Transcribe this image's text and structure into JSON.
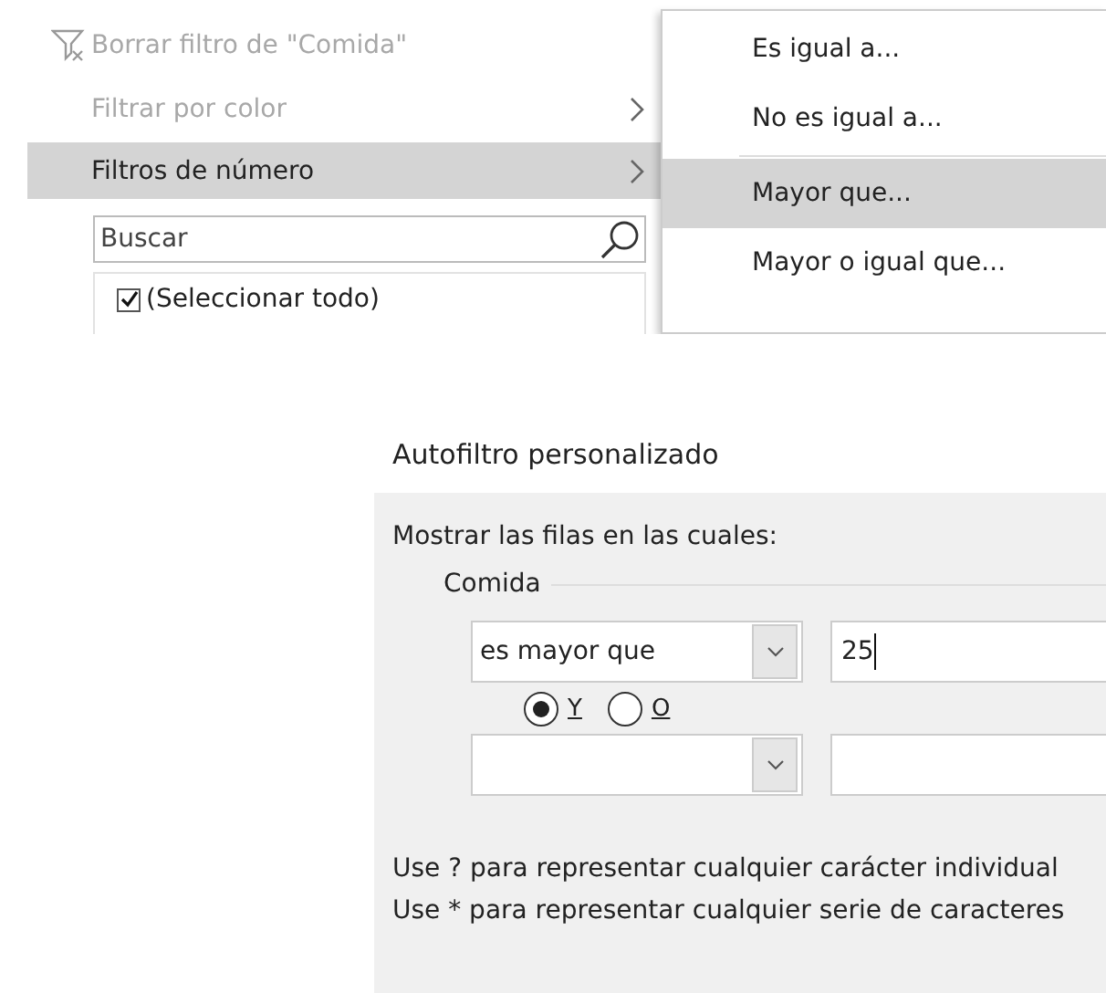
{
  "filter_menu": {
    "items": [
      {
        "kind": "command",
        "label": "Borrar filtro de \"Comida\"",
        "disabled": true,
        "selected": false
      },
      {
        "kind": "submenu",
        "label": "Filtrar por color",
        "disabled": true,
        "selected": false
      },
      {
        "kind": "submenu",
        "label": "Filtros de número",
        "disabled": false,
        "selected": true
      }
    ],
    "search": {
      "placeholder": "Buscar"
    },
    "values": [
      {
        "label": "(Seleccionar todo)",
        "checked": true
      }
    ]
  },
  "number_submenu": {
    "items": [
      {
        "label": "Es igual a...",
        "selected": false,
        "separator_after": false
      },
      {
        "label": "No es igual a...",
        "selected": false,
        "separator_after": true
      },
      {
        "label": "Mayor que...",
        "selected": true,
        "separator_after": false
      },
      {
        "label": "Mayor o igual que...",
        "selected": false,
        "separator_after": false
      }
    ]
  },
  "dialog": {
    "title": "Autofiltro personalizado",
    "prompt": "Mostrar las filas en las cuales:",
    "group": "Comida",
    "conditions": [
      {
        "operator": "es mayor que",
        "value": "25",
        "focused": true
      },
      {
        "focused": false
      }
    ],
    "joins": [
      {
        "label": "Y",
        "selected": true
      },
      {
        "label": "O",
        "selected": false
      }
    ],
    "notes": [
      "Use ? para representar cualquier carácter individual",
      "Use * para representar cualquier serie de caracteres"
    ]
  }
}
